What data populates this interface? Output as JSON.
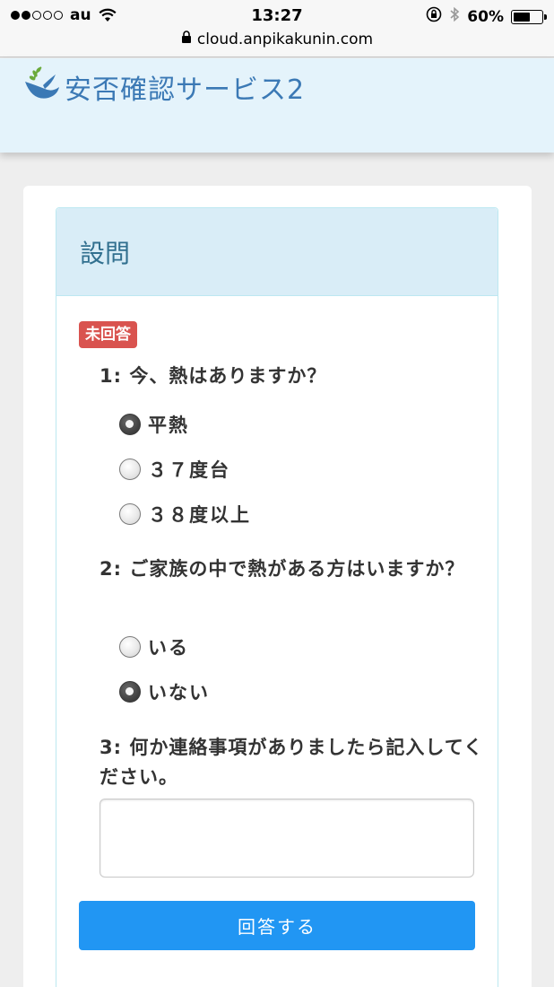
{
  "status_bar": {
    "carrier": "au",
    "time": "13:27",
    "battery": "60%",
    "battery_level": 0.6
  },
  "url_bar": {
    "url": "cloud.anpikakunin.com"
  },
  "header": {
    "logo_text": "安否確認サービス2",
    "brand_color": "#3b79b5"
  },
  "panel": {
    "title": "設問",
    "status_badge": "未回答",
    "questions": [
      {
        "number": "1:",
        "text": "今、熱はありますか？",
        "options": [
          {
            "label": "平熱",
            "selected": true
          },
          {
            "label": "３７度台",
            "selected": false
          },
          {
            "label": "３８度以上",
            "selected": false
          }
        ]
      },
      {
        "number": "2:",
        "text": "ご家族の中で熱がある方はいますか？",
        "options": [
          {
            "label": "いる",
            "selected": false
          },
          {
            "label": "いない",
            "selected": true
          }
        ]
      },
      {
        "number": "3:",
        "text": "何か連絡事項がありましたら記入してください。",
        "answer_value": ""
      }
    ],
    "submit_label": "回答する",
    "submit_color": "#2196f3"
  }
}
